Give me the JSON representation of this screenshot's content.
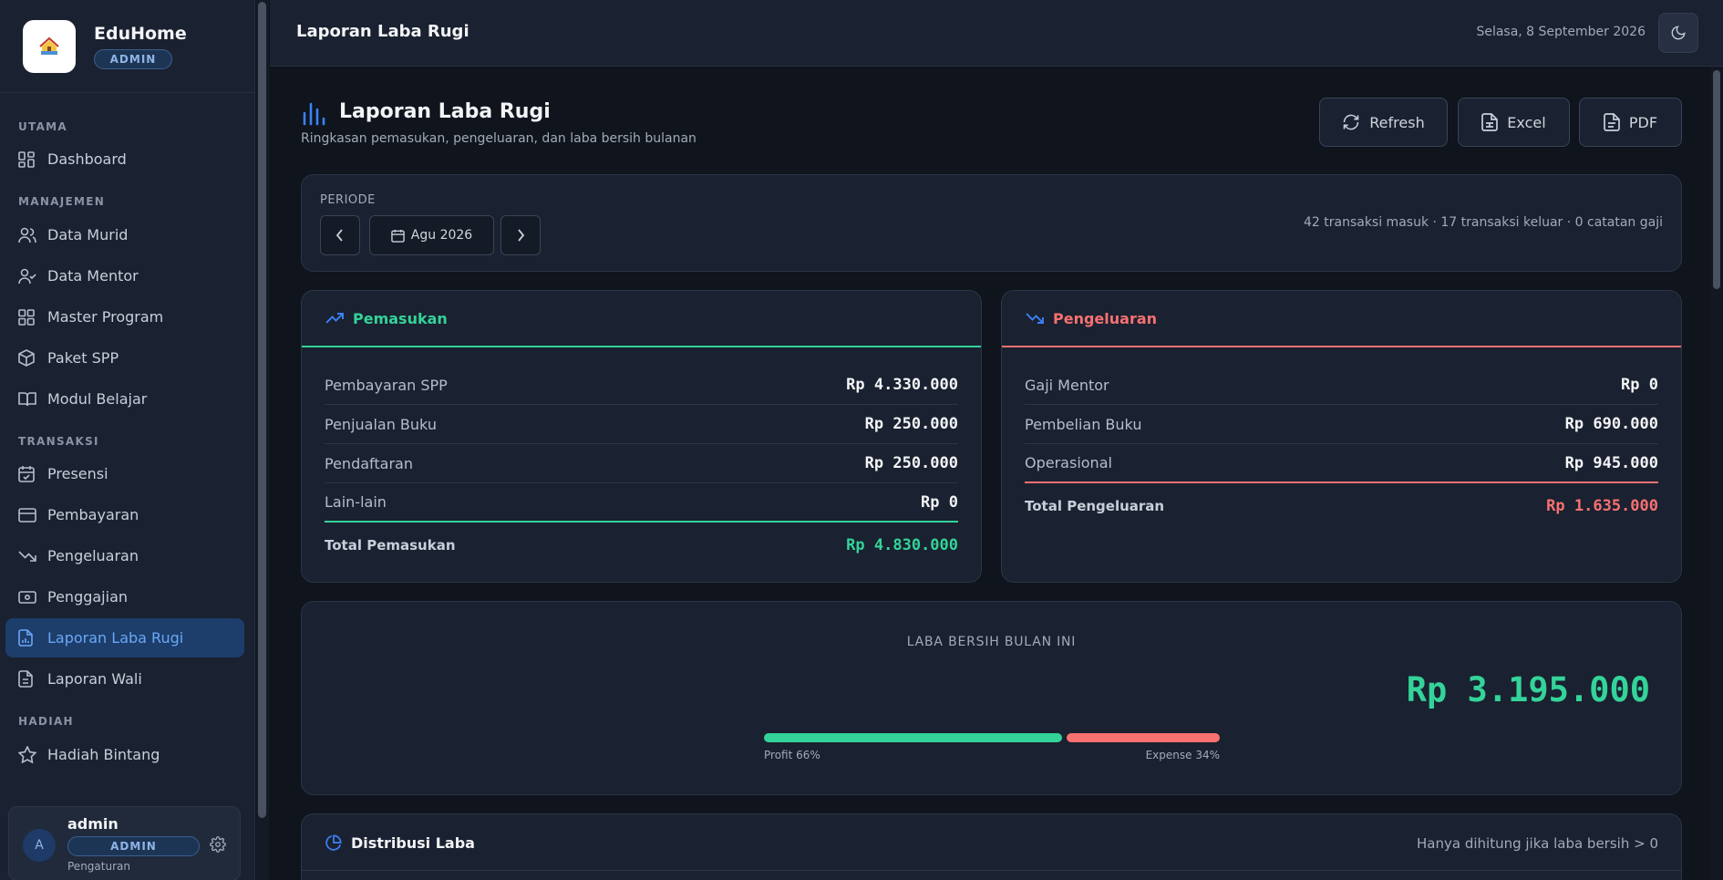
{
  "brand": {
    "name": "EduHome",
    "badge": "ADMIN"
  },
  "sidebar": {
    "sections": {
      "utama": "UTAMA",
      "manajemen": "MANAJEMEN",
      "transaksi": "TRANSAKSI",
      "hadiah": "HADIAH"
    },
    "items": {
      "dashboard": "Dashboard",
      "data_murid": "Data Murid",
      "data_mentor": "Data Mentor",
      "master_program": "Master Program",
      "paket_spp": "Paket SPP",
      "modul_belajar": "Modul Belajar",
      "presensi": "Presensi",
      "pembayaran": "Pembayaran",
      "pengeluaran": "Pengeluaran",
      "penggajian": "Penggajian",
      "laporan_laba_rugi": "Laporan Laba Rugi",
      "laporan_wali": "Laporan Wali",
      "hadiah_bintang": "Hadiah Bintang"
    },
    "active_item": "laporan_laba_rugi"
  },
  "user": {
    "initial": "A",
    "name": "admin",
    "role": "ADMIN",
    "sub": "Pengaturan"
  },
  "topbar": {
    "title": "Laporan Laba Rugi",
    "date": "Selasa, 8 September 2026"
  },
  "page": {
    "title": "Laporan Laba Rugi",
    "subtitle": "Ringkasan pemasukan, pengeluaran, dan laba bersih bulanan",
    "actions": {
      "refresh": "Refresh",
      "excel": "Excel",
      "pdf": "PDF"
    }
  },
  "period": {
    "label": "PERIODE",
    "value": "Agu 2026",
    "summary": "42 transaksi masuk · 17 transaksi keluar · 0 catatan gaji"
  },
  "income": {
    "title": "Pemasukan",
    "rows": [
      {
        "label": "Pembayaran SPP",
        "value": "Rp 4.330.000"
      },
      {
        "label": "Penjualan Buku",
        "value": "Rp 250.000"
      },
      {
        "label": "Pendaftaran",
        "value": "Rp 250.000"
      },
      {
        "label": "Lain-lain",
        "value": "Rp 0"
      }
    ],
    "total_label": "Total Pemasukan",
    "total_value": "Rp 4.830.000"
  },
  "expense": {
    "title": "Pengeluaran",
    "rows": [
      {
        "label": "Gaji Mentor",
        "value": "Rp 0"
      },
      {
        "label": "Pembelian Buku",
        "value": "Rp 690.000"
      },
      {
        "label": "Operasional",
        "value": "Rp 945.000"
      }
    ],
    "total_label": "Total Pengeluaran",
    "total_value": "Rp 1.635.000"
  },
  "net": {
    "label": "LABA BERSIH BULAN INI",
    "value": "Rp 3.195.000",
    "profit_label": "Profit 66%",
    "expense_label": "Expense 34%",
    "profit_percent": 66,
    "expense_percent": 34
  },
  "distribution": {
    "title": "Distribusi Laba",
    "note": "Hanya dihitung jika laba bersih > 0"
  },
  "colors": {
    "accent": "#3b82f6",
    "income": "#34d399",
    "expense": "#f87171"
  }
}
